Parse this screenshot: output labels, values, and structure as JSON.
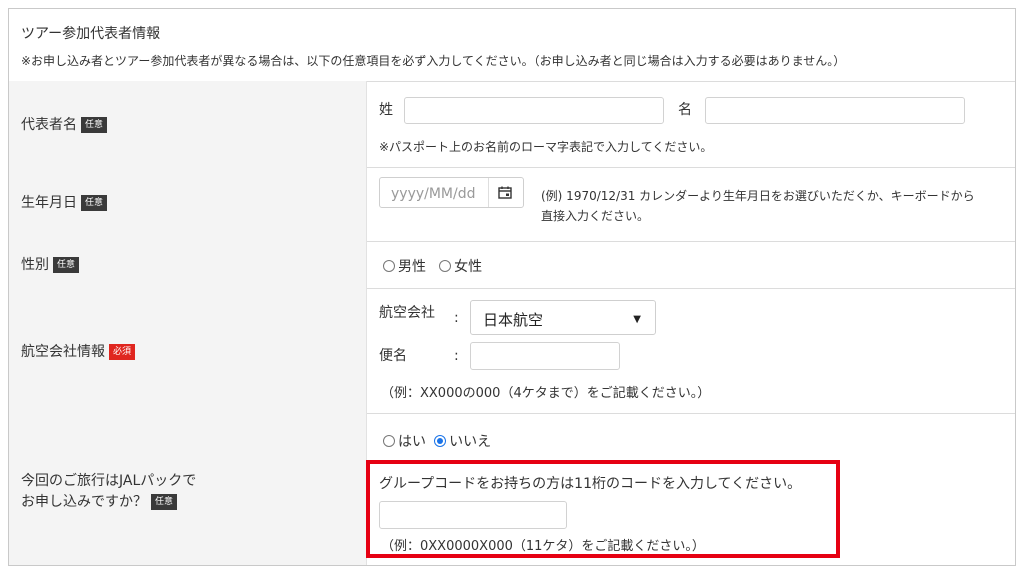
{
  "header": {
    "title": "ツアー参加代表者情報",
    "note": "※お申し込み者とツアー参加代表者が異なる場合は、以下の任意項目を必ず入力してください。（お申し込み者と同じ場合は入力する必要はありません。）"
  },
  "badges": {
    "optional": "任意",
    "required": "必須"
  },
  "representative": {
    "label": "代表者名",
    "surname_label": "姓",
    "surname_value": "",
    "given_label": "名",
    "given_value": "",
    "hint": "※パスポート上のお名前のローマ字表記で入力してください。"
  },
  "birthdate": {
    "label": "生年月日",
    "placeholder": "yyyy/MM/dd",
    "hint_line1": "(例) 1970/12/31 カレンダーより生年月日をお選びいただくか、キーボードから",
    "hint_line2": "直接入力ください。",
    "icon": "calendar-icon"
  },
  "gender": {
    "label": "性別",
    "options": [
      {
        "label": "男性",
        "selected": false
      },
      {
        "label": "女性",
        "selected": false
      }
    ]
  },
  "airline": {
    "label": "航空会社情報",
    "company_label": "航空会社",
    "colon": ":",
    "company_selected": "日本航空",
    "flight_label": "便名",
    "flight_value": "",
    "hint": "（例：XX000の000（4ケタまで）をご記載ください。）"
  },
  "jal_pack": {
    "label_line1": "今回のご旅行はJALパックで",
    "label_line2": "お申し込みですか？",
    "options": [
      {
        "label": "はい",
        "selected": false
      },
      {
        "label": "いいえ",
        "selected": true
      }
    ],
    "group_code_prompt": "グループコードをお持ちの方は11桁のコードを入力してください。",
    "group_code_value": "",
    "group_code_hint": "（例：0XX0000X000（11ケタ）をご記載ください。）",
    "highlight_color": "#e60012"
  },
  "colors": {
    "label_bg": "#f4f4f4",
    "badge_optional": "#3a3a3a",
    "badge_required": "#e0261f",
    "radio_accent": "#1a73e8"
  }
}
